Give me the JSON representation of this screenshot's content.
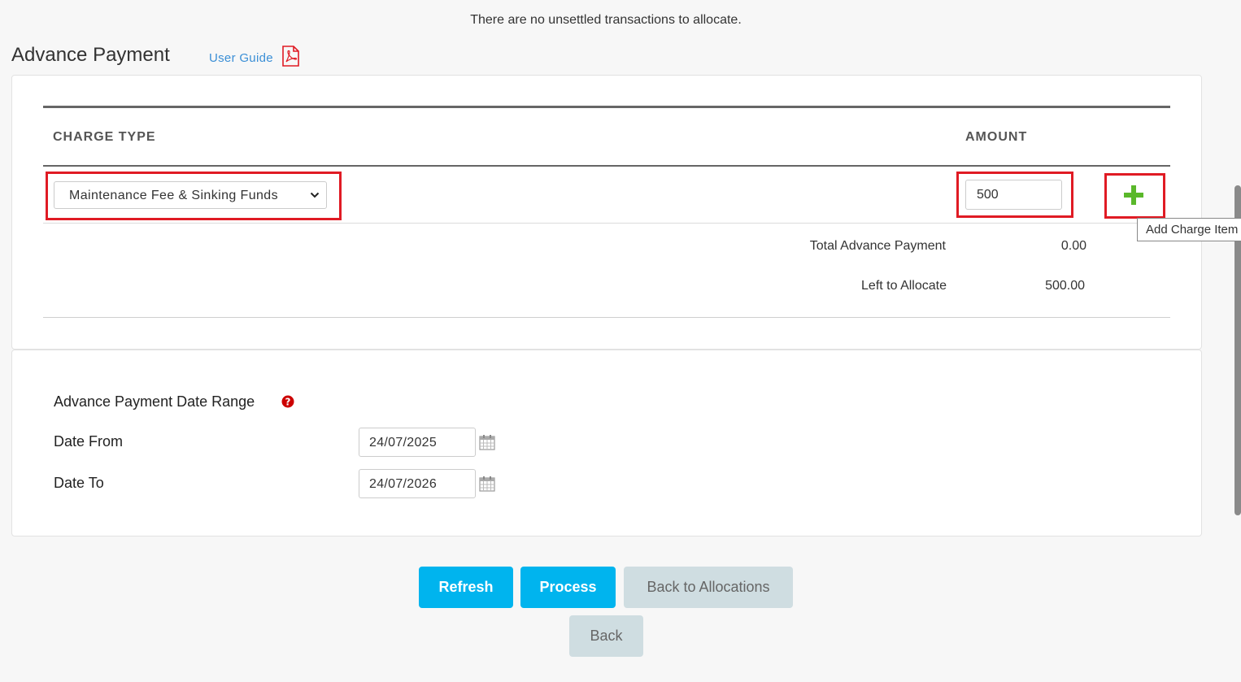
{
  "notice": "There are no unsettled transactions to allocate.",
  "page": {
    "title": "Advance Payment",
    "user_guide_label": "User Guide"
  },
  "table": {
    "headers": {
      "charge_type": "CHARGE TYPE",
      "amount": "AMOUNT"
    },
    "row": {
      "charge_type_selected": "Maintenance Fee & Sinking Funds",
      "amount_value": "500"
    },
    "add_tooltip": "Add Charge Item",
    "summary": {
      "total_label": "Total Advance Payment",
      "total_value": "0.00",
      "left_label": "Left to Allocate",
      "left_value": "500.00"
    }
  },
  "date_range": {
    "section_label": "Advance Payment Date Range",
    "from_label": "Date From",
    "from_value": "24/07/2025",
    "to_label": "Date To",
    "to_value": "24/07/2026"
  },
  "buttons": {
    "refresh": "Refresh",
    "process": "Process",
    "back_to_allocations": "Back to Allocations",
    "back": "Back"
  },
  "colors": {
    "accent": "#00b4ee",
    "highlight": "#e01b24",
    "add_green": "#5ab82b",
    "link": "#3b8fd6"
  }
}
